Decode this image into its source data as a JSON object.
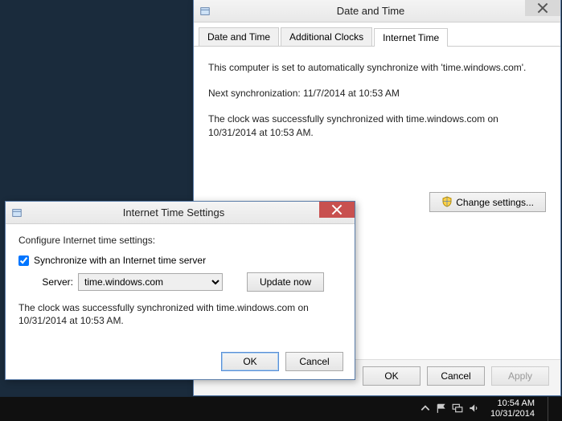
{
  "backWindow": {
    "title": "Date and Time",
    "tabs": [
      {
        "label": "Date and Time",
        "active": false
      },
      {
        "label": "Additional Clocks",
        "active": false
      },
      {
        "label": "Internet Time",
        "active": true
      }
    ],
    "body": {
      "line1": "This computer is set to automatically synchronize with 'time.windows.com'.",
      "line2": "Next synchronization: 11/7/2014 at 10:53 AM",
      "line3": "The clock was successfully synchronized with time.windows.com on 10/31/2014 at 10:53 AM."
    },
    "changeSettings": "Change settings...",
    "buttons": {
      "ok": "OK",
      "cancel": "Cancel",
      "apply": "Apply"
    }
  },
  "frontWindow": {
    "title": "Internet Time Settings",
    "instruction": "Configure Internet time settings:",
    "checkboxLabel": "Synchronize with an Internet time server",
    "checked": true,
    "serverLabel": "Server:",
    "serverValue": "time.windows.com",
    "updateNow": "Update now",
    "status": "The clock was successfully synchronized with time.windows.com on 10/31/2014 at 10:53 AM.",
    "buttons": {
      "ok": "OK",
      "cancel": "Cancel"
    }
  },
  "taskbar": {
    "time": "10:54 AM",
    "date": "10/31/2014"
  }
}
